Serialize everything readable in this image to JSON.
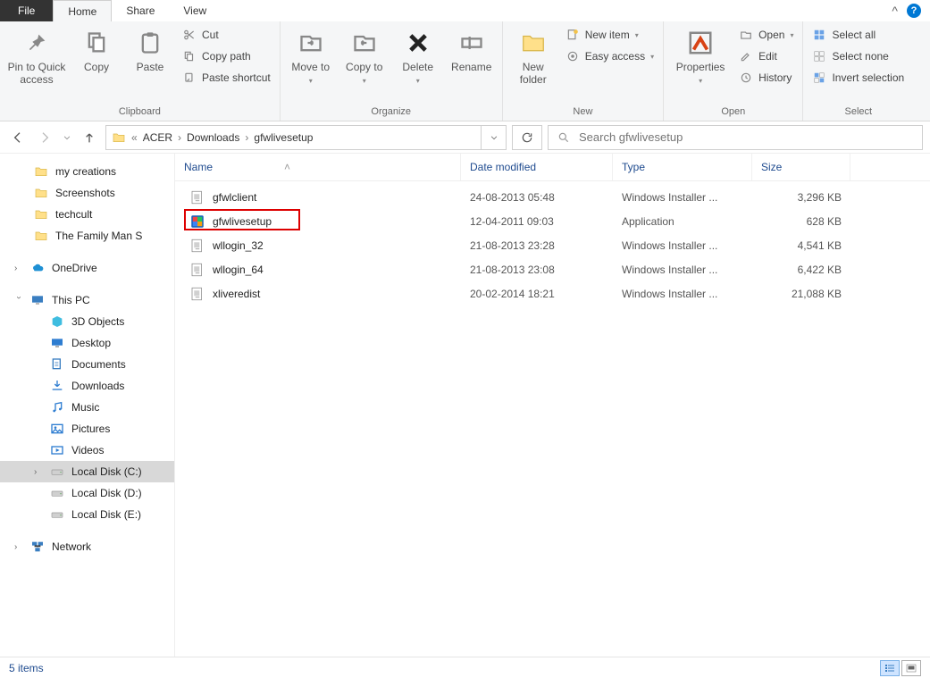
{
  "tabs": {
    "file": "File",
    "home": "Home",
    "share": "Share",
    "view": "View"
  },
  "ribbon": {
    "clipboard": {
      "label": "Clipboard",
      "pin": "Pin to Quick access",
      "copy": "Copy",
      "paste": "Paste",
      "cut": "Cut",
      "copy_path": "Copy path",
      "paste_shortcut": "Paste shortcut"
    },
    "organize": {
      "label": "Organize",
      "move_to": "Move to",
      "copy_to": "Copy to",
      "delete": "Delete",
      "rename": "Rename"
    },
    "new": {
      "label": "New",
      "new_folder": "New folder",
      "new_item": "New item",
      "easy_access": "Easy access"
    },
    "open": {
      "label": "Open",
      "properties": "Properties",
      "open": "Open",
      "edit": "Edit",
      "history": "History"
    },
    "select": {
      "label": "Select",
      "select_all": "Select all",
      "select_none": "Select none",
      "invert": "Invert selection"
    }
  },
  "breadcrumb": {
    "prefix": "«",
    "items": [
      "ACER",
      "Downloads",
      "gfwlivesetup"
    ]
  },
  "search": {
    "placeholder": "Search gfwlivesetup"
  },
  "columns": {
    "name": "Name",
    "date": "Date modified",
    "type": "Type",
    "size": "Size"
  },
  "tree": {
    "quick": [
      {
        "label": "my creations"
      },
      {
        "label": "Screenshots"
      },
      {
        "label": "techcult"
      },
      {
        "label": "The Family Man S"
      }
    ],
    "onedrive": "OneDrive",
    "thispc": "This PC",
    "pc_items": [
      {
        "label": "3D Objects",
        "icon": "3d"
      },
      {
        "label": "Desktop",
        "icon": "desktop"
      },
      {
        "label": "Documents",
        "icon": "documents"
      },
      {
        "label": "Downloads",
        "icon": "downloads"
      },
      {
        "label": "Music",
        "icon": "music"
      },
      {
        "label": "Pictures",
        "icon": "pictures"
      },
      {
        "label": "Videos",
        "icon": "videos"
      },
      {
        "label": "Local Disk (C:)",
        "icon": "disk",
        "selected": true
      },
      {
        "label": "Local Disk (D:)",
        "icon": "disk"
      },
      {
        "label": "Local Disk (E:)",
        "icon": "disk"
      }
    ],
    "network": "Network"
  },
  "files": [
    {
      "name": "gfwlclient",
      "date": "24-08-2013 05:48",
      "type": "Windows Installer ...",
      "size": "3,296 KB",
      "icon": "msi"
    },
    {
      "name": "gfwlivesetup",
      "date": "12-04-2011 09:03",
      "type": "Application",
      "size": "628 KB",
      "icon": "exe",
      "highlight": true
    },
    {
      "name": "wllogin_32",
      "date": "21-08-2013 23:28",
      "type": "Windows Installer ...",
      "size": "4,541 KB",
      "icon": "msi"
    },
    {
      "name": "wllogin_64",
      "date": "21-08-2013 23:08",
      "type": "Windows Installer ...",
      "size": "6,422 KB",
      "icon": "msi"
    },
    {
      "name": "xliveredist",
      "date": "20-02-2014 18:21",
      "type": "Windows Installer ...",
      "size": "21,088 KB",
      "icon": "msi"
    }
  ],
  "status": {
    "count": "5 items"
  }
}
